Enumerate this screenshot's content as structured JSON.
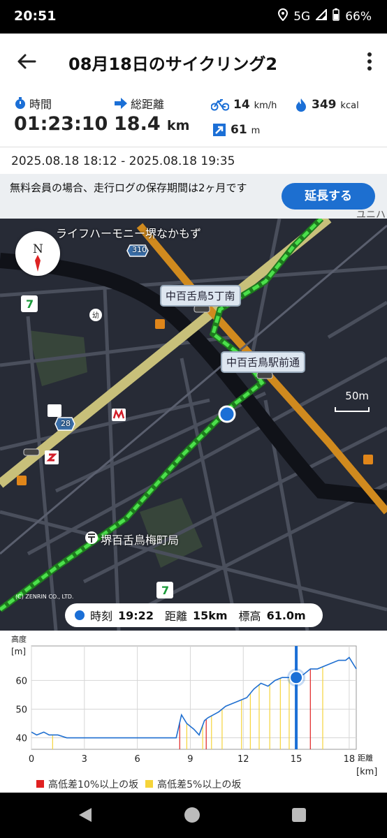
{
  "status_bar": {
    "time": "20:51",
    "network": "5G",
    "battery": "66%"
  },
  "app_bar": {
    "title": "08月18日のサイクリング2"
  },
  "stats": {
    "time_label": "時間",
    "time_value": "01:23:10",
    "distance_label": "総距離",
    "distance_value": "18.4",
    "distance_unit": "km",
    "speed_value": "14",
    "speed_unit": "km/h",
    "calories_value": "349",
    "calories_unit": "kcal",
    "climb_value": "61",
    "climb_unit": "m"
  },
  "date_range": "2025.08.18 18:12 - 2025.08.18 19:35",
  "notice": {
    "text": "無料会員の場合、走行ログの保存期間は2ヶ月です",
    "button": "延長する",
    "overflow_text": "ユニハ"
  },
  "map": {
    "compass_letter": "N",
    "labels": {
      "place_top": "ライフハーモニー堺なかもず",
      "road_310": "310",
      "road_28": "28",
      "signal_1": "中百舌鳥5丁南",
      "signal_2": "中百舌鳥駅前通",
      "post_office": "堺百舌鳥梅町局",
      "kindergarten": "幼",
      "scale": "50m",
      "copyright": "(C) ZENRIN CO., LTD."
    },
    "info": {
      "time_label": "時刻",
      "time_value": "19:22",
      "distance_label": "距離",
      "distance_value": "15km",
      "elevation_label": "標高",
      "elevation_value": "61.0m"
    }
  },
  "chart_data": {
    "type": "area",
    "ylabel": "高度",
    "yunit": "[m]",
    "xlabel": "距離",
    "xunit": "[km]",
    "x_ticks": [
      "0",
      "3",
      "6",
      "9",
      "12",
      "15",
      "18"
    ],
    "y_ticks": [
      "40",
      "50",
      "60"
    ],
    "xlim": [
      0,
      18.4
    ],
    "ylim": [
      36,
      72
    ],
    "cursor_x": 15,
    "cursor_y": 61,
    "x": [
      0,
      0.3,
      0.7,
      1,
      1.5,
      2,
      2.5,
      3,
      3.5,
      4,
      4.5,
      5,
      5.5,
      6,
      6.5,
      7,
      7.5,
      8,
      8.2,
      8.5,
      8.8,
      9,
      9.2,
      9.5,
      9.8,
      10,
      10.3,
      10.6,
      11,
      11.4,
      11.8,
      12.2,
      12.6,
      13,
      13.4,
      13.8,
      14.2,
      14.6,
      15,
      15.4,
      15.8,
      16.2,
      16.6,
      17,
      17.4,
      17.8,
      18,
      18.2,
      18.4
    ],
    "y": [
      42,
      41,
      42,
      41,
      41,
      40,
      40,
      40,
      40,
      40,
      40,
      40,
      40,
      40,
      40,
      40,
      40,
      40,
      40,
      48,
      45,
      44,
      43,
      41,
      46,
      47,
      48,
      49,
      51,
      52,
      53,
      54,
      57,
      59,
      58,
      60,
      61,
      61,
      61,
      62,
      64,
      64,
      65,
      66,
      67,
      67,
      68,
      66,
      64
    ],
    "series": [
      {
        "name": "高低差10%以上の坂",
        "color": "#e02020",
        "markers_x": [
          8.4,
          9.9,
          15,
          15.8
        ]
      },
      {
        "name": "高低差5%以上の坂",
        "color": "#f5d43a",
        "markers_x": [
          1.2,
          8.8,
          9.7,
          10.2,
          10.8,
          11.9,
          12.4,
          12.9,
          13.5,
          14.1,
          14.6,
          16.5
        ]
      }
    ],
    "colors": {
      "line": "#1f6fd0",
      "grid": "#d6d6d6"
    }
  }
}
